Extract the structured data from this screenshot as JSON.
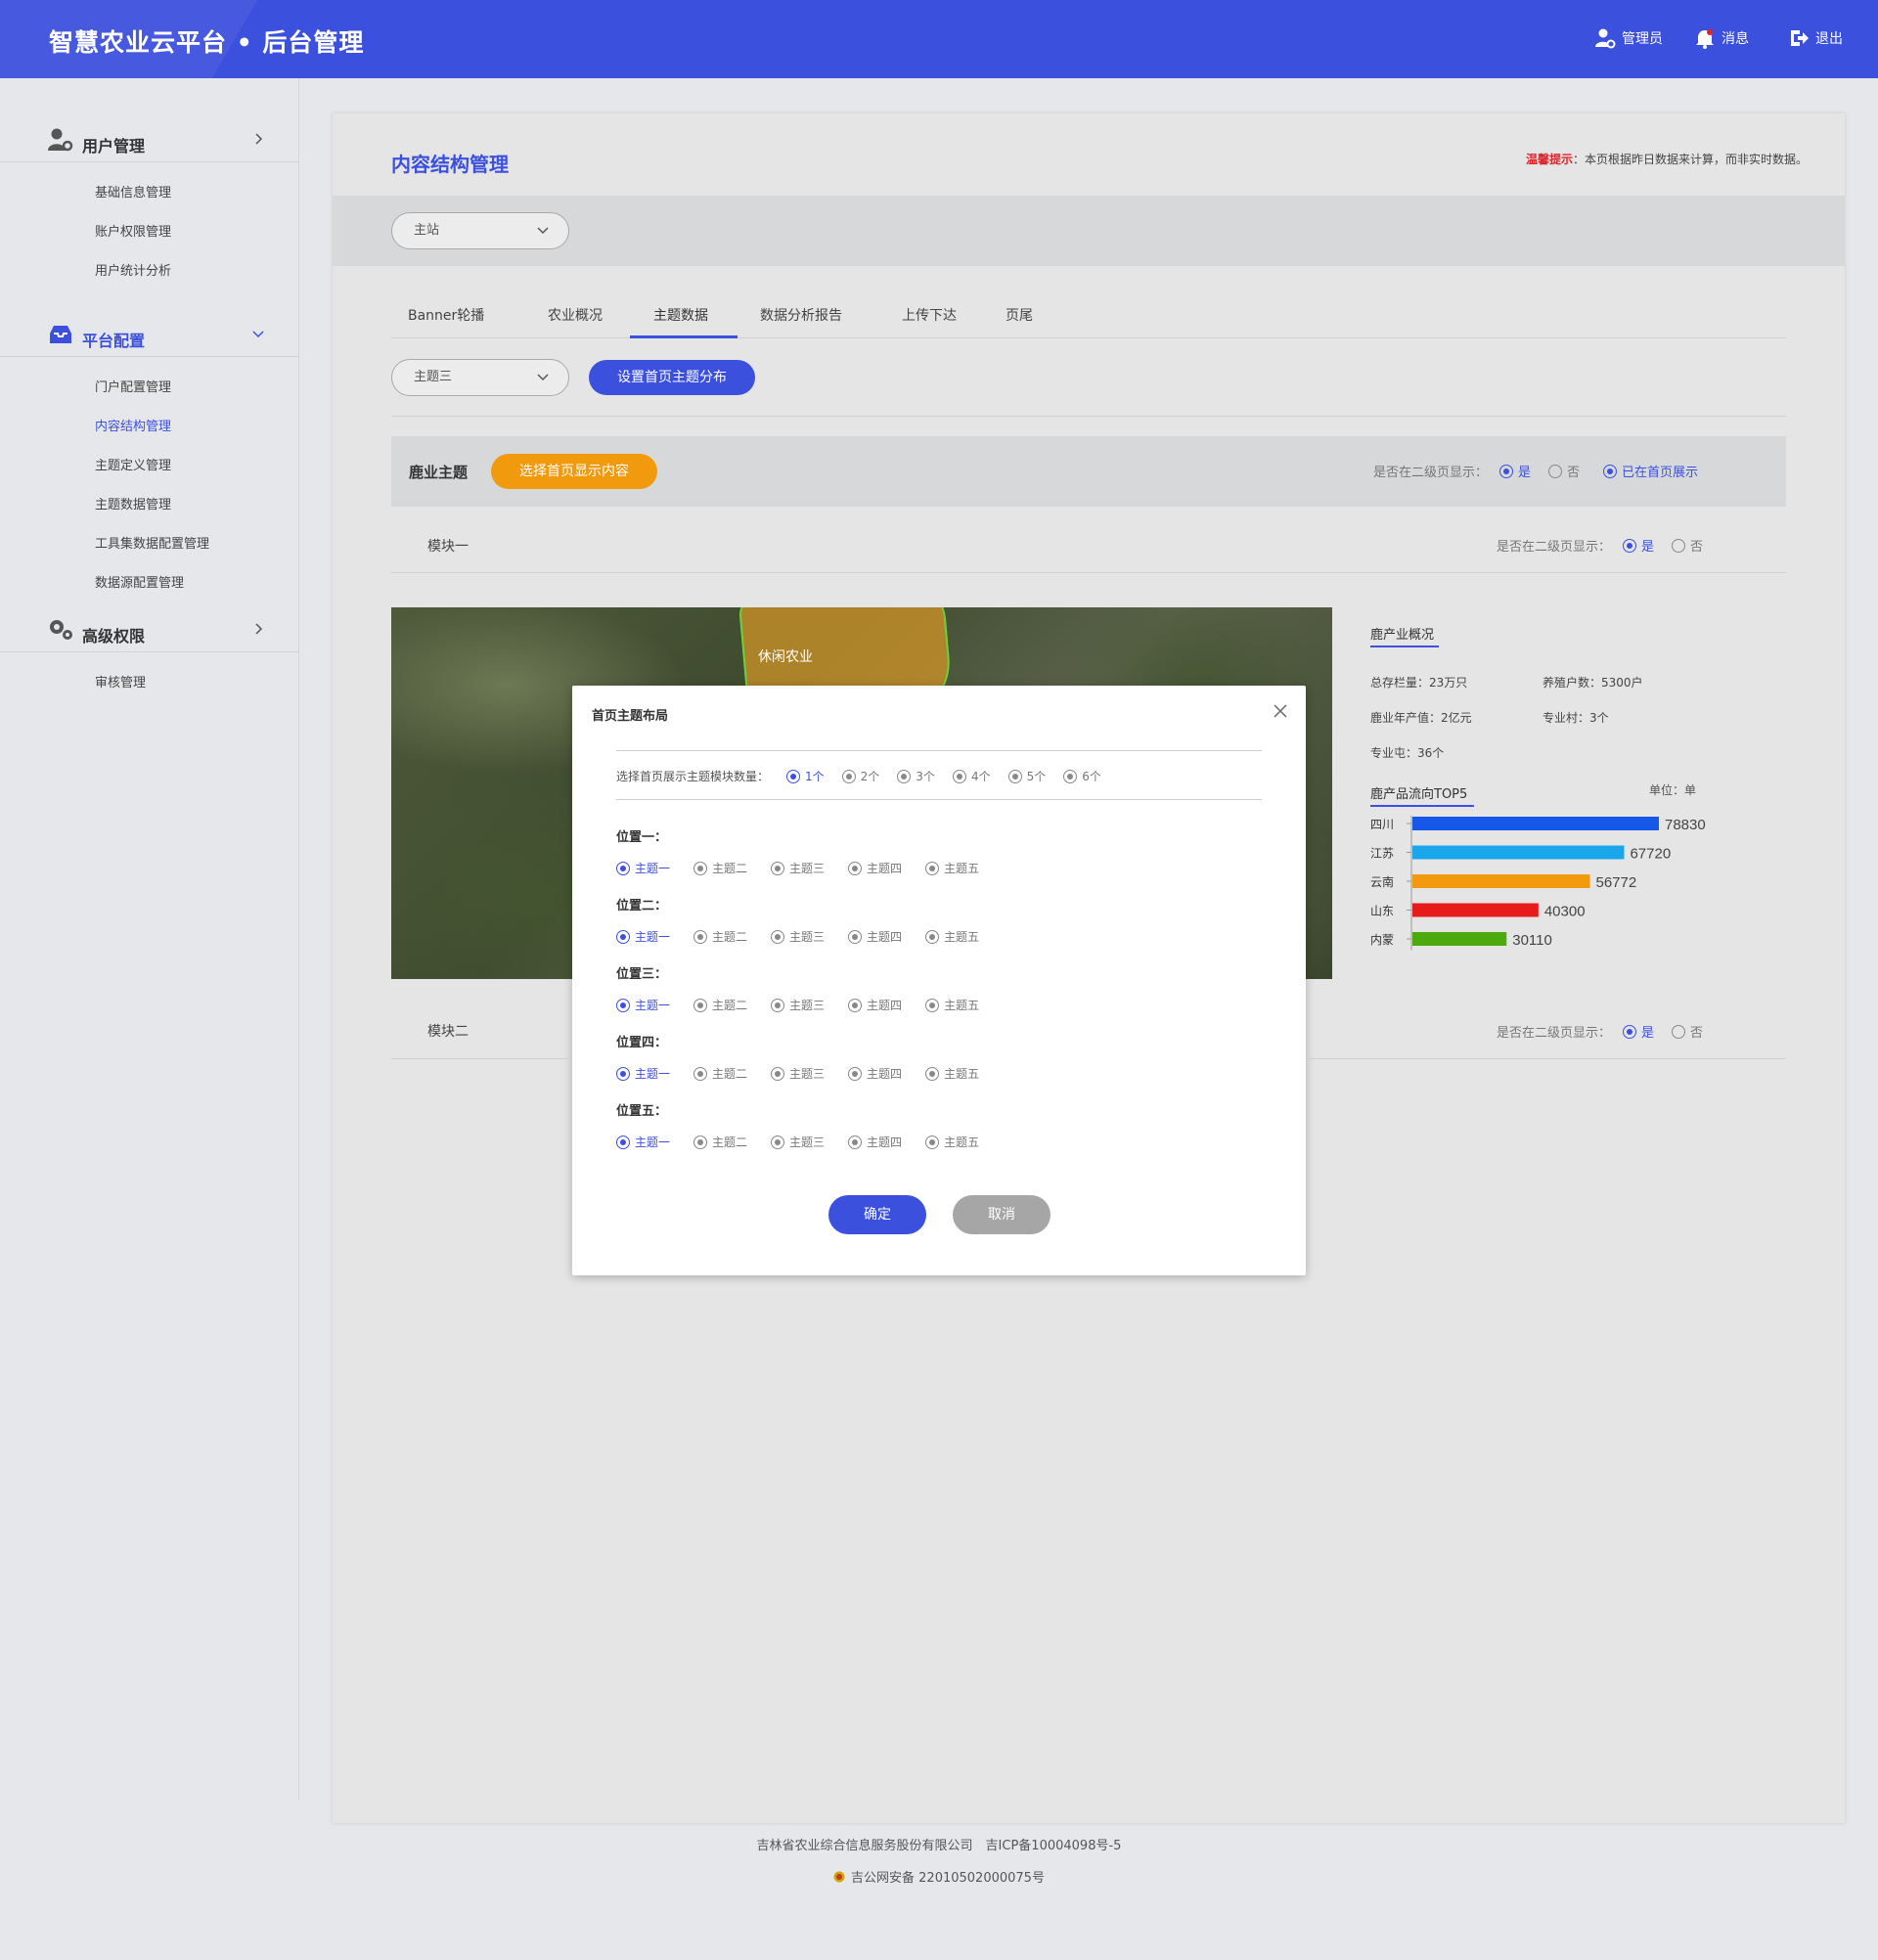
{
  "header": {
    "title": "智慧农业云平台 • 后台管理",
    "admin_label": "管理员",
    "message_label": "消息",
    "logout_label": "退出"
  },
  "sidebar": {
    "sections": [
      {
        "label": "用户管理",
        "items": [
          "基础信息管理",
          "账户权限管理",
          "用户统计分析"
        ]
      },
      {
        "label": "平台配置",
        "items": [
          "门户配置管理",
          "内容结构管理",
          "主题定义管理",
          "主题数据管理",
          "工具集数据配置管理",
          "数据源配置管理"
        ]
      },
      {
        "label": "高级权限",
        "items": [
          "审核管理"
        ]
      }
    ]
  },
  "main": {
    "title": "内容结构管理",
    "tip_label": "温馨提示",
    "tip_text": "：本页根据昨日数据来计算，而非实时数据。",
    "site_select": "主站",
    "tabs": [
      "Banner轮播",
      "农业概况",
      "主题数据",
      "数据分析报告",
      "上传下达",
      "页尾"
    ],
    "theme_select": "主题三",
    "set_dist_button": "设置首页主题分布",
    "theme_name": "鹿业主题",
    "choose_button": "选择首页显示内容",
    "secondary_question": "是否在二级页显示：",
    "yes": "是",
    "no": "否",
    "shown_on_home": "已在首页展示",
    "module1": "模块一",
    "module2": "模块二",
    "map_label": "休闲农业"
  },
  "stats": {
    "overview_title": "鹿产业概况",
    "items": [
      "总存栏量：23万只",
      "养殖户数：5300户",
      "鹿业年产值：2亿元",
      "专业村：3个",
      "专业屯：36个"
    ],
    "flow_title": "鹿产品流向TOP5",
    "unit": "单位：单"
  },
  "chart_data": {
    "type": "bar",
    "orientation": "horizontal",
    "title": "鹿产品流向TOP5",
    "categories": [
      "四川",
      "江苏",
      "云南",
      "山东",
      "内蒙"
    ],
    "values": [
      78830,
      67720,
      56772,
      40300,
      30110
    ],
    "colors": [
      "#1557e6",
      "#19a6ea",
      "#f19a0d",
      "#e81b1b",
      "#4caa0e"
    ],
    "xlim": [
      0,
      78830
    ]
  },
  "modal": {
    "title": "首页主题布局",
    "count_label": "选择首页展示主题模块数量：",
    "count_options": [
      "1个",
      "2个",
      "3个",
      "4个",
      "5个",
      "6个"
    ],
    "positions": [
      "位置一：",
      "位置二：",
      "位置三：",
      "位置四：",
      "位置五："
    ],
    "theme_options": [
      "主题一",
      "主题二",
      "主题三",
      "主题四",
      "主题五"
    ],
    "confirm": "确定",
    "cancel": "取消"
  },
  "footer": {
    "line1": "吉林省农业综合信息服务股份有限公司　吉ICP备10004098号-5",
    "line2": "吉公网安备 22010502000075号"
  },
  "colors": {
    "primary": "#3c50de",
    "orange": "#f19a0d",
    "warning": "#e0242a",
    "cancel": "#a6a6a6"
  }
}
